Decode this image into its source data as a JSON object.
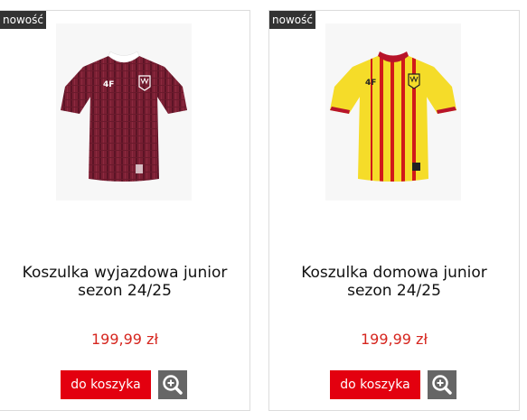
{
  "products": [
    {
      "badge": "nowość",
      "name_line1": "Koszulka wyjazdowa junior",
      "name_line2": "sezon 24/25",
      "price": "199,99 zł",
      "add_label": "do koszyka",
      "image_icon": "shirt-maroon-image",
      "shirt_color": "#7a1f33",
      "collar_color": "#ffffff"
    },
    {
      "badge": "nowość",
      "name_line1": "Koszulka domowa junior",
      "name_line2": "sezon 24/25",
      "price": "199,99 zł",
      "add_label": "do koszyka",
      "image_icon": "shirt-yellow-image",
      "shirt_color": "#f5dc29",
      "stripe_color": "#d11a1a"
    }
  ],
  "colors": {
    "accent": "#e3000f",
    "price": "#d6261f",
    "badge_bg": "#333333",
    "zoom_bg": "#666666"
  },
  "zoom_icon": "zoom-in-icon"
}
